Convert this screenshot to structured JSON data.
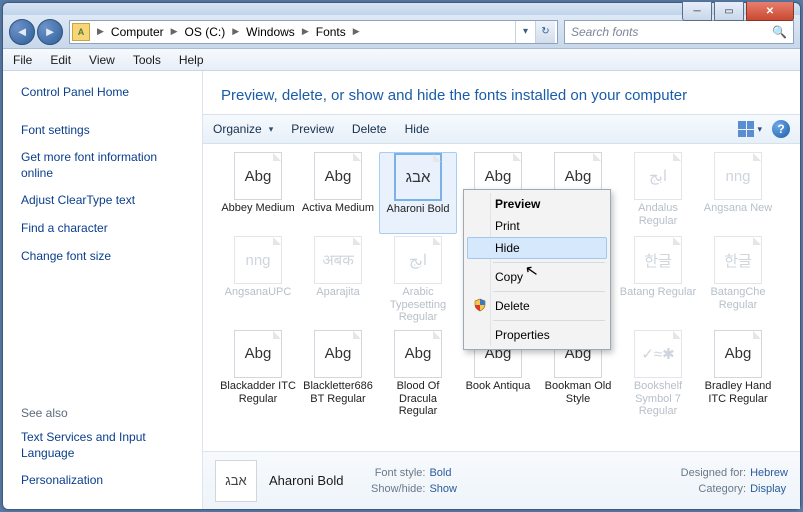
{
  "window": {
    "breadcrumbs": [
      "Computer",
      "OS (C:)",
      "Windows",
      "Fonts"
    ],
    "search_placeholder": "Search fonts"
  },
  "menubar": [
    "File",
    "Edit",
    "View",
    "Tools",
    "Help"
  ],
  "sidebar": {
    "home": "Control Panel Home",
    "links": [
      "Font settings",
      "Get more font information online",
      "Adjust ClearType text",
      "Find a character",
      "Change font size"
    ],
    "see_also_label": "See also",
    "see_also": [
      "Text Services and Input Language",
      "Personalization"
    ]
  },
  "main": {
    "heading": "Preview, delete, or show and hide the fonts installed on your computer",
    "toolbar": {
      "organize": "Organize",
      "preview": "Preview",
      "delete": "Delete",
      "hide": "Hide"
    }
  },
  "fonts": [
    {
      "glyph": "Abg",
      "label": "Abbey Medium",
      "dim": false
    },
    {
      "glyph": "Abg",
      "label": "Activa Medium",
      "dim": false
    },
    {
      "glyph": "אבג",
      "label": "Aharoni Bold",
      "dim": false,
      "selected": true
    },
    {
      "glyph": "Abg",
      "label": "",
      "dim": false
    },
    {
      "glyph": "Abg",
      "label": "",
      "dim": false
    },
    {
      "glyph": "ابج",
      "label": "Andalus Regular",
      "dim": true
    },
    {
      "glyph": "nng",
      "label": "Angsana New",
      "dim": true,
      "stack": true
    },
    {
      "glyph": "nng",
      "label": "AngsanaUPC",
      "dim": true,
      "stack": true
    },
    {
      "glyph": "अबक",
      "label": "Aparajita",
      "dim": true,
      "stack": true
    },
    {
      "glyph": "ابج",
      "label": "Arabic Typesetting Regular",
      "dim": true
    },
    {
      "glyph": "",
      "label": "",
      "dim": false
    },
    {
      "glyph": "",
      "label": "",
      "dim": false
    },
    {
      "glyph": "한글",
      "label": "Batang Regular",
      "dim": true
    },
    {
      "glyph": "한글",
      "label": "BatangChe Regular",
      "dim": true
    },
    {
      "glyph": "Abg",
      "label": "Blackadder ITC Regular",
      "dim": false
    },
    {
      "glyph": "Abg",
      "label": "Blackletter686 BT Regular",
      "dim": false
    },
    {
      "glyph": "Abg",
      "label": "Blood Of Dracula Regular",
      "dim": false
    },
    {
      "glyph": "Abg",
      "label": "Book Antiqua",
      "dim": false,
      "stack": true
    },
    {
      "glyph": "Abg",
      "label": "Bookman Old Style",
      "dim": false,
      "stack": true
    },
    {
      "glyph": "✓≈✱",
      "label": "Bookshelf Symbol 7 Regular",
      "dim": true
    },
    {
      "glyph": "Abg",
      "label": "Bradley Hand ITC Regular",
      "dim": false
    }
  ],
  "context_menu": {
    "items": [
      {
        "label": "Preview",
        "bold": true
      },
      {
        "label": "Print"
      },
      {
        "label": "Hide",
        "hover": true
      },
      {
        "sep": true
      },
      {
        "label": "Copy"
      },
      {
        "sep": true
      },
      {
        "label": "Delete",
        "shield": true
      },
      {
        "sep": true
      },
      {
        "label": "Properties"
      }
    ]
  },
  "details": {
    "name": "Aharoni Bold",
    "glyph": "אבג",
    "font_style_label": "Font style:",
    "font_style": "Bold",
    "show_hide_label": "Show/hide:",
    "show_hide": "Show",
    "designed_for_label": "Designed for:",
    "designed_for": "Hebrew",
    "category_label": "Category:",
    "category": "Display"
  }
}
